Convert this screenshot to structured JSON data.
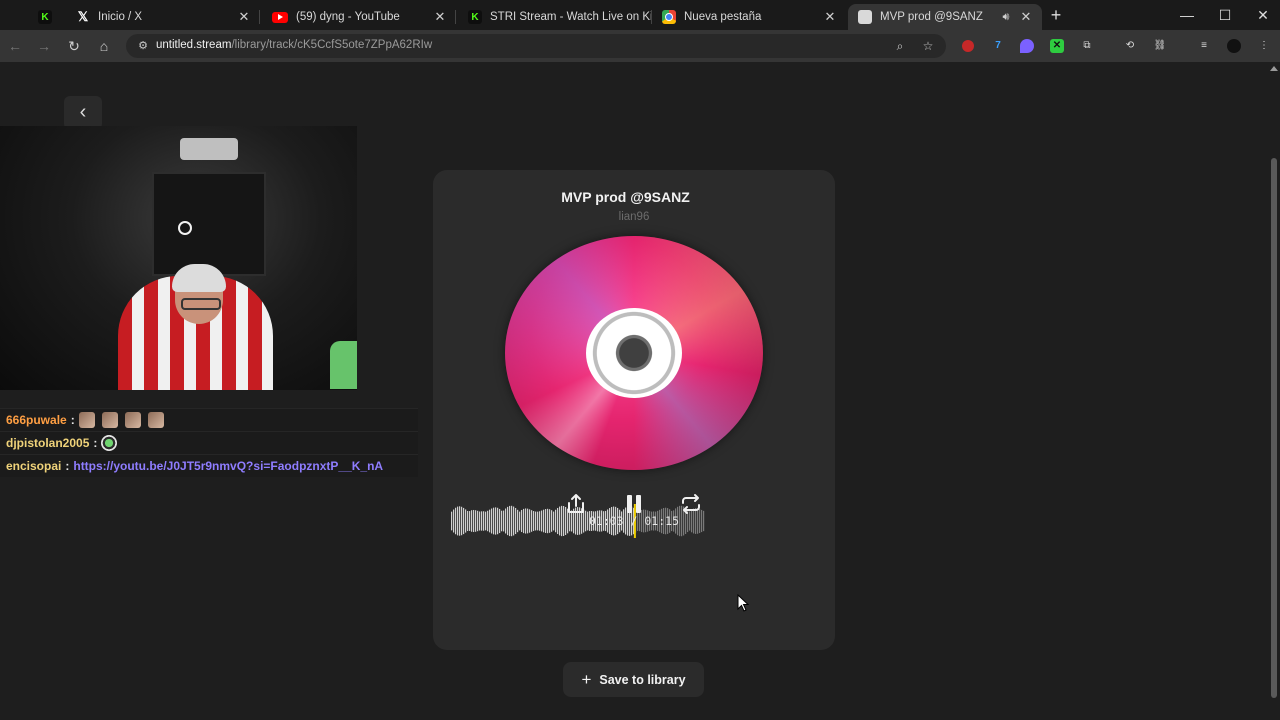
{
  "browser": {
    "tabs": [
      {
        "icon": "kick-icon",
        "label": "",
        "active": false
      },
      {
        "icon": "x-icon",
        "label": "Inicio / X",
        "active": false
      },
      {
        "icon": "youtube-icon",
        "label": "(59) dyng - YouTube",
        "active": false
      },
      {
        "icon": "kick-icon",
        "label": "STRI Stream - Watch Live on Kick",
        "active": false
      },
      {
        "icon": "chrome-icon",
        "label": "Nueva pestaña",
        "active": false
      },
      {
        "icon": "untitled-icon",
        "label": "MVP prod @9SANZ",
        "active": true
      }
    ],
    "address": {
      "host": "untitled.stream",
      "path": "/library/track/cK5CcfS5ote7ZPpA62RIw"
    }
  },
  "stream_overlay": {
    "chat": [
      {
        "user": "666puwale",
        "user_color": "#ff9f43",
        "message": "",
        "emotes": 4
      },
      {
        "user": "djpistolan2005",
        "user_color": "#f0d37a",
        "message": "",
        "emotes": 1
      },
      {
        "user": "encisopai",
        "user_color": "#f0d37a",
        "link": "https://youtu.be/J0JT5r9nmvQ?si=FaodpznxtP__K_nA"
      }
    ]
  },
  "player": {
    "title": "MVP prod @9SANZ",
    "artist": "lian96",
    "current_time": "01:03",
    "total_time": "01:15",
    "time_display": "01:03 / 01:15",
    "progress": 0.72,
    "save_label": "Save to library"
  },
  "colors": {
    "background": "#1e1e1e",
    "card": "#2b2b2b",
    "playhead": "#f0d000",
    "disc": "#e5256f"
  }
}
